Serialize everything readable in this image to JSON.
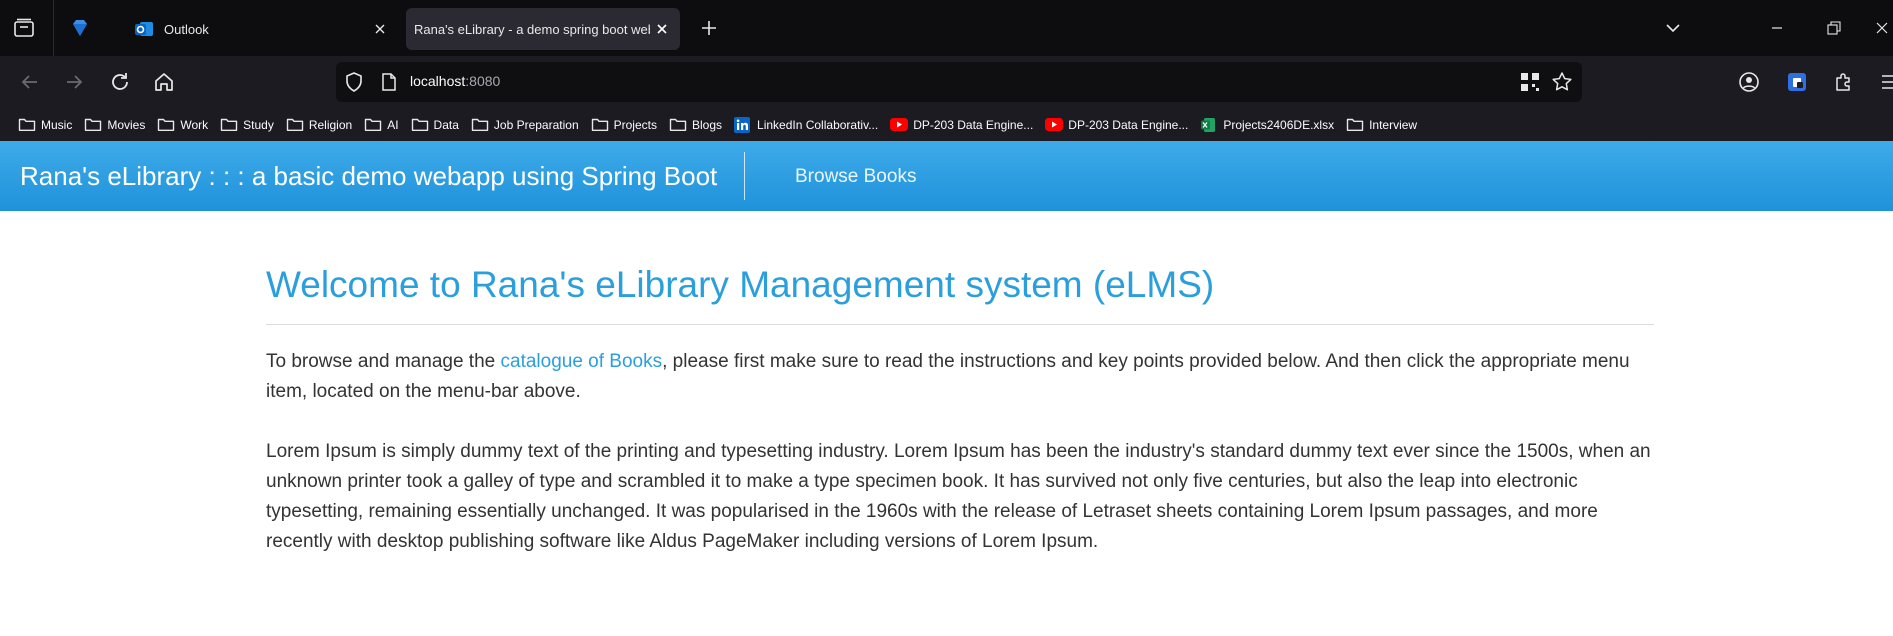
{
  "browser": {
    "tabs": [
      {
        "title": "Outlook",
        "active": false
      },
      {
        "title": "Rana's eLibrary - a demo spring boot webapp",
        "active": true
      }
    ],
    "url": {
      "host": "localhost",
      "port": ":8080"
    },
    "bookmarks": [
      {
        "label": "Music",
        "icon": "folder-icon"
      },
      {
        "label": "Movies",
        "icon": "folder-icon"
      },
      {
        "label": "Work",
        "icon": "folder-icon"
      },
      {
        "label": "Study",
        "icon": "folder-icon"
      },
      {
        "label": "Religion",
        "icon": "folder-icon"
      },
      {
        "label": "AI",
        "icon": "folder-icon"
      },
      {
        "label": "Data",
        "icon": "folder-icon"
      },
      {
        "label": "Job Preparation",
        "icon": "folder-icon"
      },
      {
        "label": "Projects",
        "icon": "folder-icon"
      },
      {
        "label": "Blogs",
        "icon": "folder-icon"
      },
      {
        "label": "LinkedIn Collaborativ...",
        "icon": "linkedin-icon"
      },
      {
        "label": "DP-203 Data Engine...",
        "icon": "youtube-icon"
      },
      {
        "label": "DP-203 Data Engine...",
        "icon": "youtube-icon"
      },
      {
        "label": "Projects2406DE.xlsx",
        "icon": "excel-icon"
      },
      {
        "label": "Interview",
        "icon": "folder-icon"
      }
    ]
  },
  "page": {
    "brand": "Rana's eLibrary : : : a basic demo webapp using Spring Boot",
    "nav_link": "Browse Books",
    "heading": "Welcome to Rana's eLibrary Management system (eLMS)",
    "intro_before": "To browse and manage the ",
    "intro_link": "catalogue of Books",
    "intro_after": ", please first make sure to read the instructions and key points provided below. And then click the appropriate menu item, located on the menu-bar above.",
    "lorem": "Lorem Ipsum is simply dummy text of the printing and typesetting industry. Lorem Ipsum has been the industry's standard dummy text ever since the 1500s, when an unknown printer took a galley of type and scrambled it to make a type specimen book. It has survived not only five centuries, but also the leap into electronic typesetting, remaining essentially unchanged. It was popularised in the 1960s with the release of Letraset sheets containing Lorem Ipsum passages, and more recently with desktop publishing software like Aldus PageMaker including versions of Lorem Ipsum."
  },
  "colors": {
    "nav_gradient_top": "#3eabe9",
    "nav_gradient_bottom": "#1f92da",
    "heading": "#2a9fdc",
    "link": "#2a9fdc",
    "text": "#333333"
  }
}
